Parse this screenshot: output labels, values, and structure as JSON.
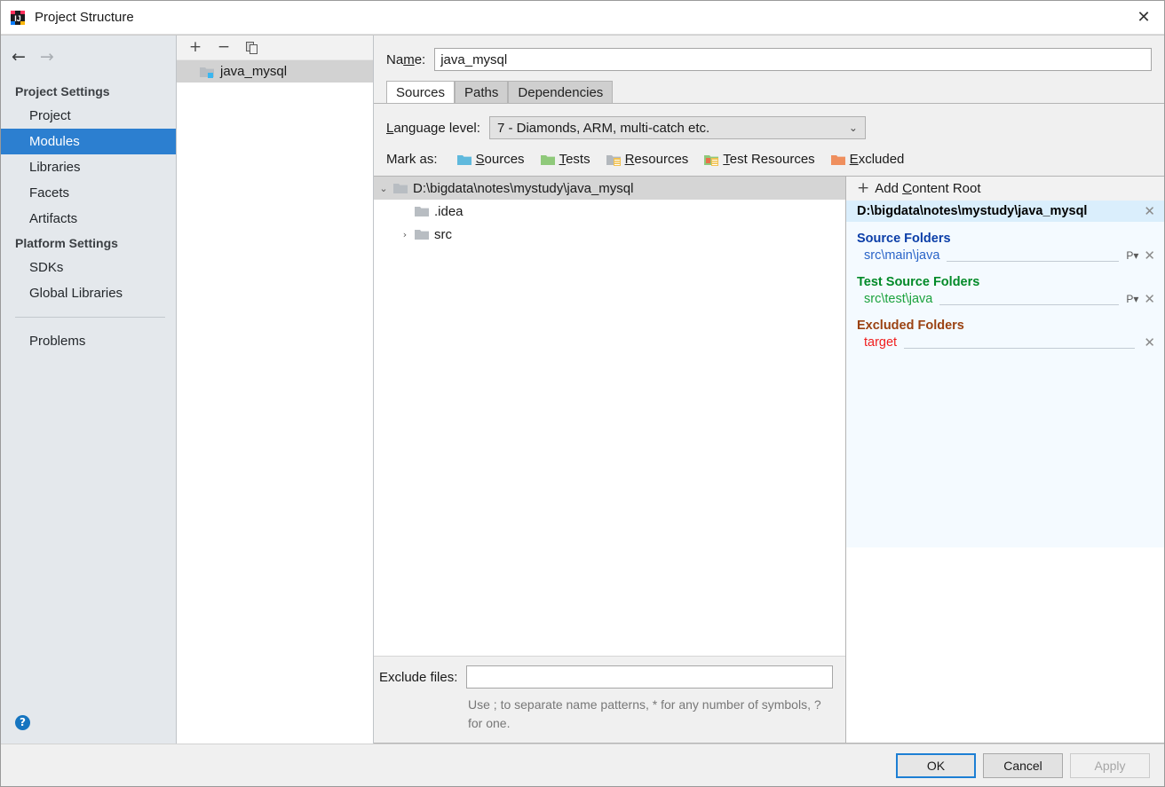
{
  "window": {
    "title": "Project Structure",
    "icon": "intellij-idea-logo-icon",
    "close_label": "✕"
  },
  "sidebar": {
    "nav": {
      "back": "←",
      "forward": "→"
    },
    "groups": [
      {
        "label": "Project Settings",
        "items": [
          "Project",
          "Modules",
          "Libraries",
          "Facets",
          "Artifacts"
        ]
      },
      {
        "label": "Platform Settings",
        "items": [
          "SDKs",
          "Global Libraries"
        ]
      }
    ],
    "extra_items": [
      "Problems"
    ],
    "selected": "Modules",
    "help_label": "?"
  },
  "modules_panel": {
    "toolbar": {
      "add": "+",
      "remove": "−",
      "copy": "❐"
    },
    "items": [
      {
        "label": "java_mysql",
        "icon": "module-folder-icon",
        "selected": true
      }
    ]
  },
  "module_editor": {
    "name_label_pre": "Na",
    "name_label_mnemonic": "m",
    "name_label_post": "e:",
    "name_value": "java_mysql",
    "tabs": [
      {
        "label": "Sources",
        "active": true
      },
      {
        "label": "Paths",
        "active": false
      },
      {
        "label": "Dependencies",
        "active": false
      }
    ],
    "language_level": {
      "label_mnemonic": "L",
      "label_rest": "anguage level:",
      "value": "7 - Diamonds, ARM, multi-catch etc.",
      "arrow": "⌄"
    },
    "mark_as": {
      "label": "Mark as:",
      "options": [
        {
          "pre": "",
          "mnemonic": "S",
          "post": "ources",
          "icon": "sources-folder-icon",
          "color": "#5fb9dd"
        },
        {
          "pre": "",
          "mnemonic": "T",
          "post": "ests",
          "icon": "tests-folder-icon",
          "color": "#8fc97a"
        },
        {
          "pre": "",
          "mnemonic": "R",
          "post": "esources",
          "icon": "resources-folder-icon",
          "color": "#b3b8bd"
        },
        {
          "pre": "",
          "mnemonic": "T",
          "post": "est Resources",
          "icon": "test-resources-folder-icon",
          "color": "#8fc97a"
        },
        {
          "pre": "",
          "mnemonic": "E",
          "post": "xcluded",
          "icon": "excluded-folder-icon",
          "color": "#ef8f5e"
        }
      ]
    },
    "tree": [
      {
        "label": "D:\\bigdata\\notes\\mystudy\\java_mysql",
        "indent": 0,
        "twisty": "⌄",
        "selected": true
      },
      {
        "label": ".idea",
        "indent": 1,
        "twisty": "",
        "selected": false
      },
      {
        "label": "src",
        "indent": 1,
        "twisty": "›",
        "selected": false
      }
    ],
    "exclude": {
      "label": "Exclude files:",
      "value": "",
      "placeholder": "",
      "hint": "Use ; to separate name patterns, * for any number of symbols, ? for one."
    }
  },
  "content_roots": {
    "add_label_pre": "Add ",
    "add_label_mnemonic": "C",
    "add_label_post": "ontent Root",
    "add_icon": "plus-icon",
    "root_path": "D:\\bigdata\\notes\\mystudy\\java_mysql",
    "remove_icon": "✕",
    "sections": [
      {
        "title": "Source Folders",
        "kind": "src",
        "paths": [
          {
            "path": "src\\main\\java",
            "prefix_icon": "P▾",
            "remove_icon": "✕"
          }
        ]
      },
      {
        "title": "Test Source Folders",
        "kind": "test",
        "paths": [
          {
            "path": "src\\test\\java",
            "prefix_icon": "P▾",
            "remove_icon": "✕"
          }
        ]
      },
      {
        "title": "Excluded Folders",
        "kind": "excl",
        "paths": [
          {
            "path": "target",
            "prefix_icon": "",
            "remove_icon": "✕"
          }
        ]
      }
    ]
  },
  "footer": {
    "ok": "OK",
    "cancel": "Cancel",
    "apply": "Apply"
  },
  "colors": {
    "selection_blue": "#2c7fd0",
    "source_blue": "#0b3ea8",
    "test_green": "#028a28",
    "excluded_brown": "#9b4212",
    "excluded_red": "#f01e1e",
    "root_header_bg": "#daeefc"
  }
}
